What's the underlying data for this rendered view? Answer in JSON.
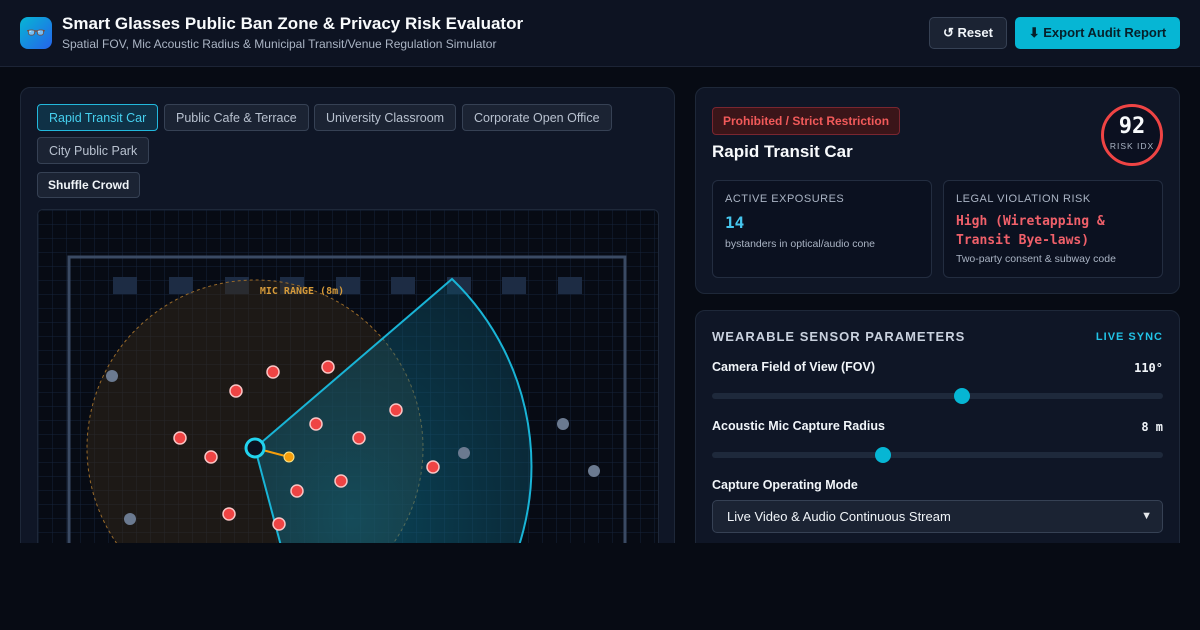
{
  "header": {
    "logo_icon": "👓",
    "title": "Smart Glasses Public Ban Zone & Privacy Risk Evaluator",
    "subtitle": "Spatial FOV, Mic Acoustic Radius & Municipal Transit/Venue Regulation Simulator",
    "reset_label": "↺ Reset",
    "export_label": "⬇ Export Audit Report"
  },
  "scenarios": {
    "tabs": [
      {
        "label": "Rapid Transit Car",
        "active": true
      },
      {
        "label": "Public Cafe & Terrace",
        "active": false
      },
      {
        "label": "University Classroom",
        "active": false
      },
      {
        "label": "Corporate Open Office",
        "active": false
      },
      {
        "label": "City Public Park",
        "active": false
      }
    ],
    "shuffle_label": "Shuffle Crowd"
  },
  "map": {
    "mic_label": "MIC RANGE (8m)"
  },
  "status": {
    "badge": "Prohibited / Strict Restriction",
    "environment": "Rapid Transit Car",
    "risk_value": "92",
    "risk_label": "RISK IDX",
    "exposures_head": "Active Exposures",
    "exposures_value": "14",
    "exposures_sub": "bystanders in optical/audio cone",
    "legal_head": "Legal Violation Risk",
    "legal_value": "High (Wiretapping & Transit Bye-laws)",
    "legal_sub": "Two-party consent & subway code"
  },
  "params": {
    "title": "Wearable Sensor Parameters",
    "live": "LIVE SYNC",
    "fov_label": "Camera Field of View (FOV)",
    "fov_value": "110°",
    "fov_level": 0.555,
    "mic_label": "Acoustic Mic Capture Radius",
    "mic_value": "8 m",
    "mic_level": 0.38,
    "mode_label": "Capture Operating Mode",
    "mode_value": "Live Video & Audio Continuous Stream"
  },
  "colors": {
    "accent": "#06b6d4",
    "danger": "#ef4444",
    "mic": "#d59a3a"
  }
}
